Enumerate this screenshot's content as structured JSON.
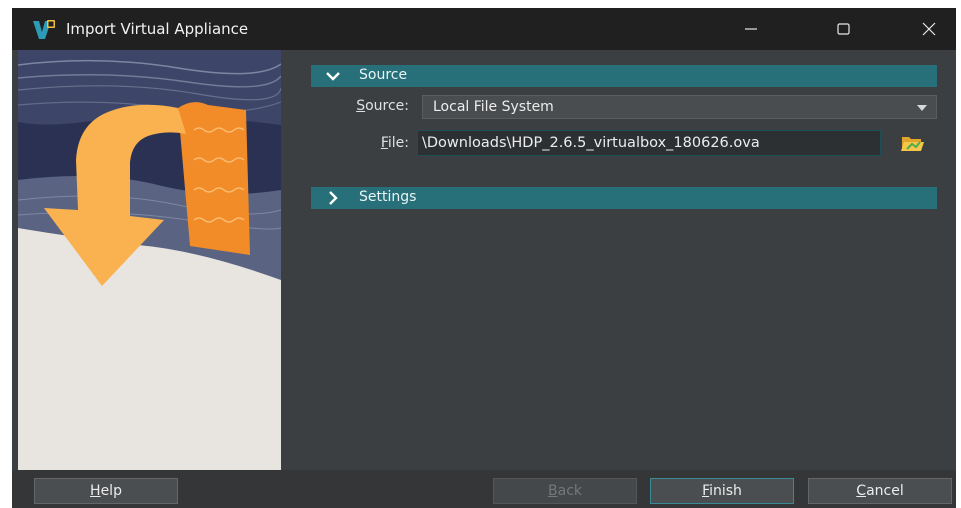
{
  "window": {
    "title": "Import Virtual Appliance",
    "controls": [
      "minimize-icon",
      "maximize-icon",
      "close-icon"
    ]
  },
  "source_section": {
    "title": "Source",
    "source_label_accel": "S",
    "source_label_rest": "ource:",
    "source_value": "Local File System",
    "file_label_accel": "F",
    "file_label_rest": "ile:",
    "file_value": "\\Downloads\\HDP_2.6.5_virtualbox_180626.ova"
  },
  "settings_section": {
    "title": "Settings"
  },
  "buttons": {
    "help_accel": "H",
    "help_rest": "elp",
    "back_accel": "B",
    "back_rest": "ack",
    "finish_accel": "F",
    "finish_rest": "inish",
    "cancel_accel": "C",
    "cancel_rest": "ancel"
  },
  "colors": {
    "section_header": "#27707a",
    "window_bg": "#3c3f41",
    "titlebar_bg": "#202020",
    "arrow_yellow": "#f9b24f",
    "arrow_orange": "#f28c28"
  }
}
